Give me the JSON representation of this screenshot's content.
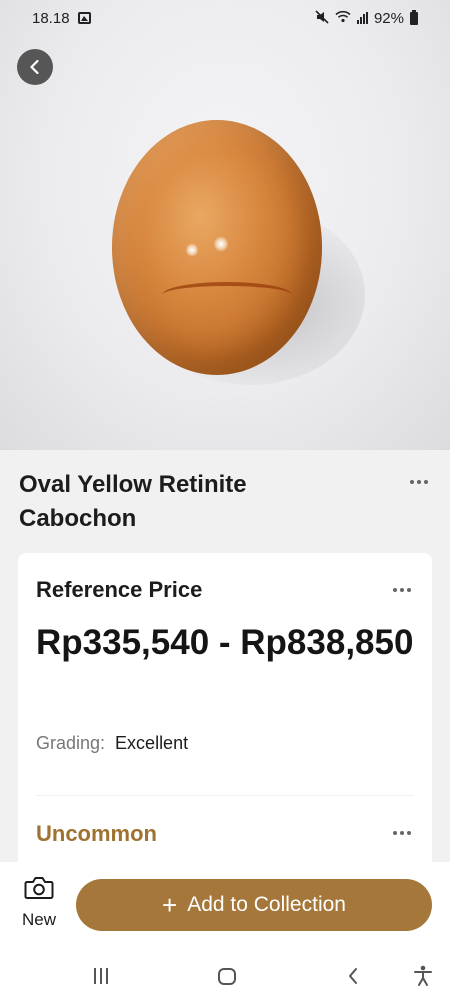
{
  "status_bar": {
    "time": "18.18",
    "battery": "92%",
    "icons": [
      "image-icon",
      "mute-icon",
      "wifi-icon",
      "signal-icon",
      "battery-icon"
    ]
  },
  "header": {
    "back_icon": "chevron-left-icon"
  },
  "product": {
    "title": "Oval Yellow Retinite Cabochon",
    "more_icon": "more-horizontal-icon"
  },
  "price_card": {
    "label": "Reference Price",
    "price": "Rp335,540 - Rp838,850",
    "grading_label": "Grading:",
    "grading_value": "Excellent",
    "rarity": "Uncommon"
  },
  "actions": {
    "new_label": "New",
    "new_icon": "camera-icon",
    "add_label": "Add to Collection"
  },
  "colors": {
    "accent": "#a5773a",
    "rarity": "#a07232",
    "background": "#f1f1f1"
  },
  "system_nav": {
    "icons": [
      "recents-icon",
      "home-icon",
      "back-icon",
      "accessibility-icon"
    ]
  }
}
